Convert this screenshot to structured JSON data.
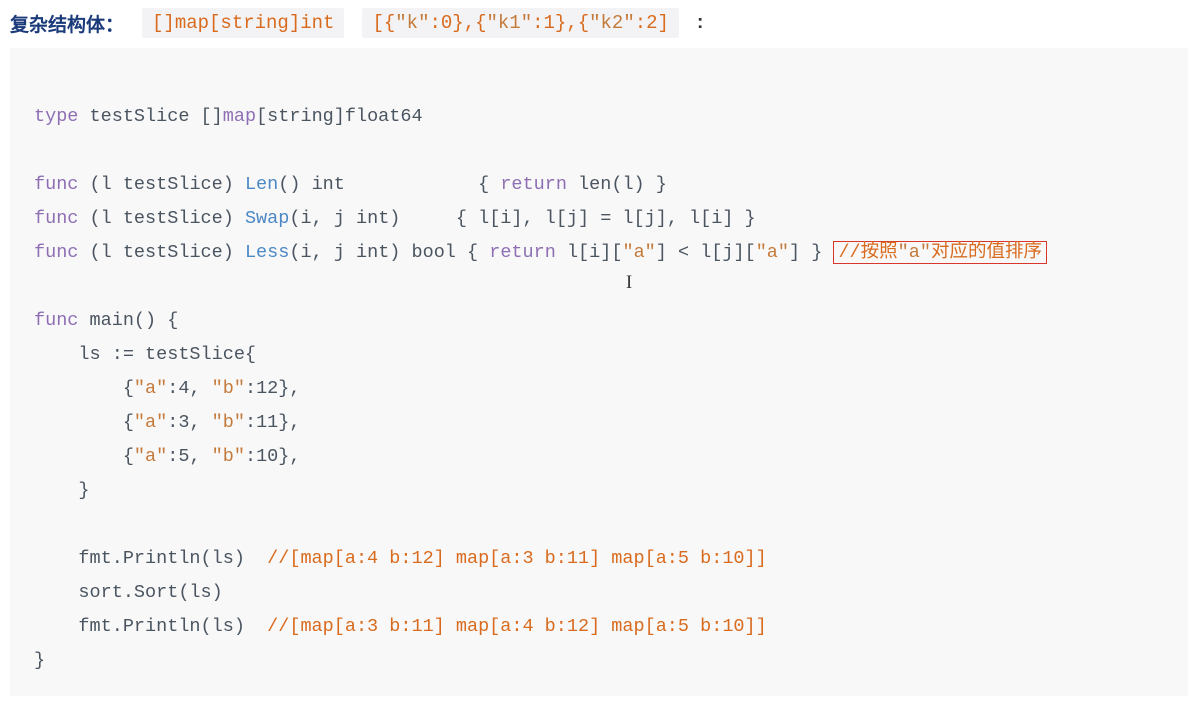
{
  "header": {
    "label": "复杂结构体：",
    "chip1": "[]map[string]int",
    "chip2_pre": "[{",
    "chip2_k0": "\"k\"",
    "chip2_mid0": ":0},{",
    "chip2_k1": "\"k1\"",
    "chip2_mid1": ":1},{",
    "chip2_k2": "\"k2\"",
    "chip2_end": ":2]",
    "trail": ":"
  },
  "code": {
    "typedecl_kw": "type",
    "typedecl_rest": " testSlice []",
    "typedecl_map": "map",
    "typedecl_sig": "[string]float64",
    "func_kw": "func",
    "len_sig": " (l testSlice) ",
    "len_name": "Len",
    "len_params": "() int            { ",
    "return_kw": "return",
    "len_body": " len(l) }",
    "swap_sig": " (l testSlice) ",
    "swap_name": "Swap",
    "swap_params": "(i, j int)     { l[i], l[j] = l[j], l[i] }",
    "less_sig": " (l testSlice) ",
    "less_name": "Less",
    "less_params": "(i, j int) bool { ",
    "less_body_pre": " l[i][",
    "less_a1": "\"a\"",
    "less_mid": "] < l[j][",
    "less_a2": "\"a\"",
    "less_end": "] } ",
    "less_comment_pre": "//按照",
    "less_comment_str": "\"a\"",
    "less_comment_post": "对应的值排序",
    "main_sig": " main() {",
    "assign": "    ls := testSlice{",
    "row1_pre": "        {",
    "row1_a": "\"a\"",
    "row1_mid": ":4, ",
    "row1_b": "\"b\"",
    "row1_end": ":12},",
    "row2_pre": "        {",
    "row2_a": "\"a\"",
    "row2_mid": ":3, ",
    "row2_b": "\"b\"",
    "row2_end": ":11},",
    "row3_pre": "        {",
    "row3_a": "\"a\"",
    "row3_mid": ":5, ",
    "row3_b": "\"b\"",
    "row3_end": ":10},",
    "close_brace": "    }",
    "print1": "    fmt.Println(ls)  ",
    "print1_cmt": "//[map[a:4 b:12] map[a:3 b:11] map[a:5 b:10]]",
    "sort_line": "    sort.Sort(ls)",
    "print2": "    fmt.Println(ls)  ",
    "print2_cmt": "//[map[a:3 b:11] map[a:4 b:12] map[a:5 b:10]]",
    "end_brace": "}"
  },
  "cursor_glyph": "I"
}
